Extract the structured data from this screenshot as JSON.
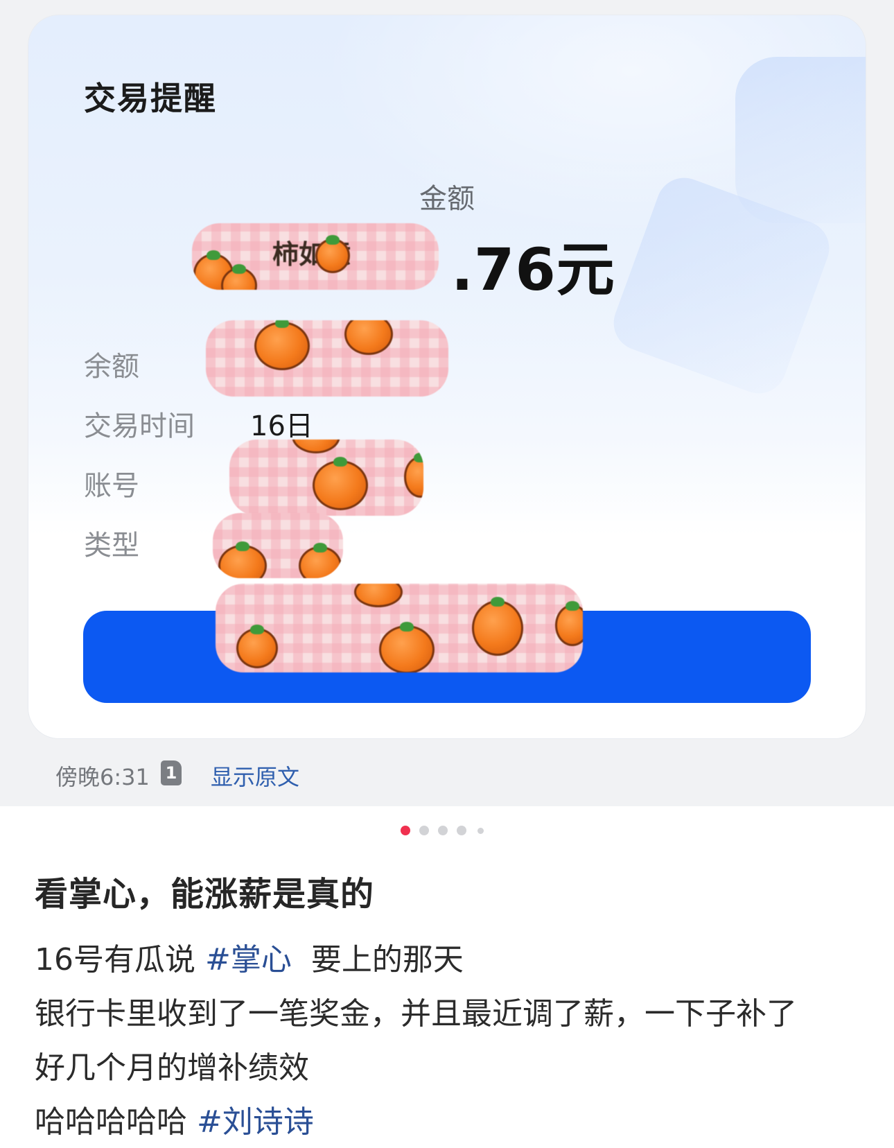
{
  "card": {
    "title": "交易提醒",
    "amount_label": "金额",
    "amount_value_visible": ".76元",
    "rows": [
      {
        "label": "余额",
        "value": ""
      },
      {
        "label": "交易时间",
        "value": "16日"
      },
      {
        "label": "账号",
        "value": ""
      },
      {
        "label": "类型",
        "value": ""
      }
    ],
    "sticker_text": "柿如意"
  },
  "meta": {
    "time": "傍晚6:31",
    "sim": "1",
    "show_original": "显示原文"
  },
  "carousel": {
    "count": 5,
    "active_index": 0
  },
  "post": {
    "title": "看掌心，能涨薪是真的",
    "line1_a": "16号有瓜说 ",
    "line1_tag": "#掌心",
    "line1_b": "  要上的那天",
    "line2": "银行卡里收到了一笔奖金，并且最近调了薪，一下子补了",
    "line3": "好几个月的增补绩效",
    "line4_a": "哈哈哈哈哈 ",
    "line4_tag": "#刘诗诗"
  },
  "colors": {
    "accent_button": "#0c59f2",
    "link": "#2f5fae",
    "tag": "#2a4f95",
    "active_dot": "#f0304f"
  }
}
